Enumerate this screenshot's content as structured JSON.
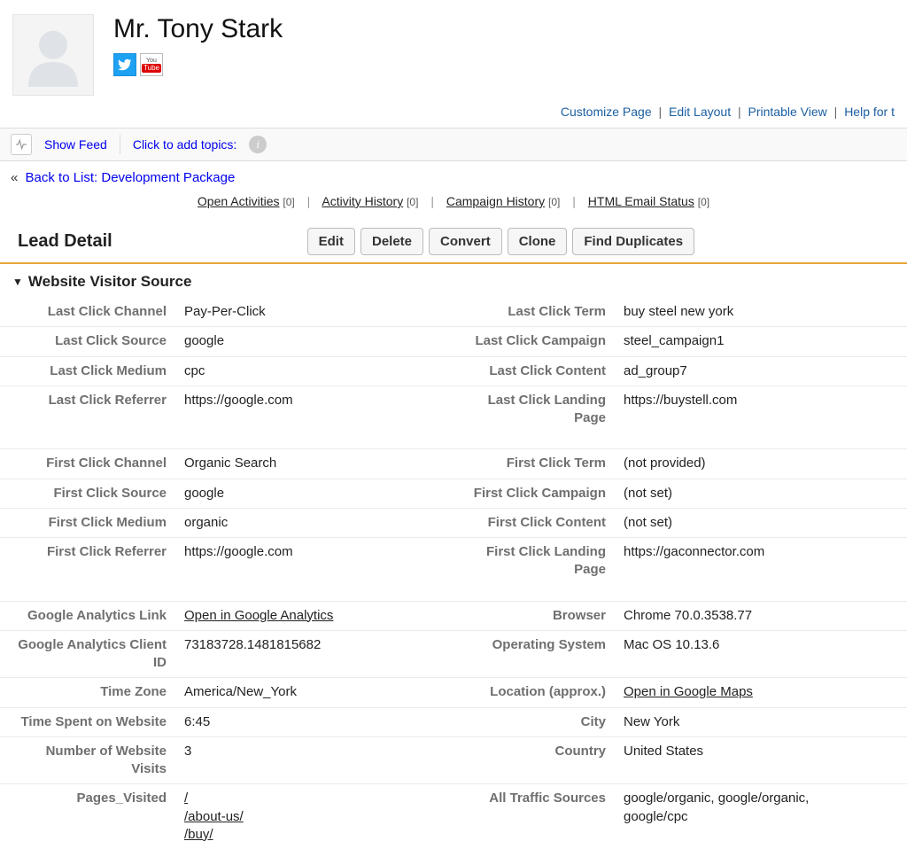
{
  "header": {
    "name": "Mr. Tony Stark"
  },
  "top_links": {
    "customize": "Customize Page",
    "edit_layout": "Edit Layout",
    "printable": "Printable View",
    "help": "Help for t"
  },
  "feed_bar": {
    "show_feed": "Show Feed",
    "add_topics": "Click to add topics:"
  },
  "back_link": "Back to List: Development Package",
  "related": {
    "open_activities": "Open Activities",
    "open_activities_count": "[0]",
    "activity_history": "Activity History",
    "activity_history_count": "[0]",
    "campaign_history": "Campaign History",
    "campaign_history_count": "[0]",
    "html_email_status": "HTML Email Status",
    "html_email_status_count": "[0]"
  },
  "detail_title": "Lead Detail",
  "buttons": {
    "edit": "Edit",
    "delete": "Delete",
    "convert": "Convert",
    "clone": "Clone",
    "find_duplicates": "Find Duplicates"
  },
  "section_title": "Website Visitor Source",
  "labels": {
    "last_click_channel": "Last Click Channel",
    "last_click_source": "Last Click Source",
    "last_click_medium": "Last Click Medium",
    "last_click_referrer": "Last Click Referrer",
    "last_click_term": "Last Click Term",
    "last_click_campaign": "Last Click Campaign",
    "last_click_content": "Last Click Content",
    "last_click_landing": "Last Click Landing Page",
    "first_click_channel": "First Click Channel",
    "first_click_source": "First Click Source",
    "first_click_medium": "First Click Medium",
    "first_click_referrer": "First Click Referrer",
    "first_click_term": "First Click Term",
    "first_click_campaign": "First Click Campaign",
    "first_click_content": "First Click Content",
    "first_click_landing": "First Click Landing Page",
    "ga_link": "Google Analytics Link",
    "ga_client_id": "Google Analytics Client ID",
    "time_zone": "Time Zone",
    "time_spent": "Time Spent on Website",
    "visits": "Number of Website Visits",
    "pages_visited": "Pages_Visited",
    "browser": "Browser",
    "os": "Operating System",
    "location": "Location (approx.)",
    "city": "City",
    "country": "Country",
    "all_sources": "All Traffic Sources"
  },
  "values": {
    "last_click_channel": "Pay-Per-Click",
    "last_click_source": "google",
    "last_click_medium": "cpc",
    "last_click_referrer": "https://google.com",
    "last_click_term": "buy steel new york",
    "last_click_campaign": "steel_campaign1",
    "last_click_content": "ad_group7",
    "last_click_landing": "https://buystell.com",
    "first_click_channel": "Organic Search",
    "first_click_source": "google",
    "first_click_medium": "organic",
    "first_click_referrer": "https://google.com",
    "first_click_term": "(not provided)",
    "first_click_campaign": "(not set)",
    "first_click_content": "(not set)",
    "first_click_landing": "https://gaconnector.com",
    "ga_link": "Open in Google Analytics",
    "ga_client_id": "73183728.1481815682",
    "time_zone": "America/New_York",
    "time_spent": "6:45",
    "visits": "3",
    "pages_visited_1": "/",
    "pages_visited_2": "/about-us/",
    "pages_visited_3": "/buy/",
    "browser": "Chrome 70.0.3538.77",
    "os": "Mac OS 10.13.6",
    "location": "Open in Google Maps",
    "city": "New York",
    "country": "United States",
    "all_sources": "google/organic, google/organic, google/cpc"
  }
}
